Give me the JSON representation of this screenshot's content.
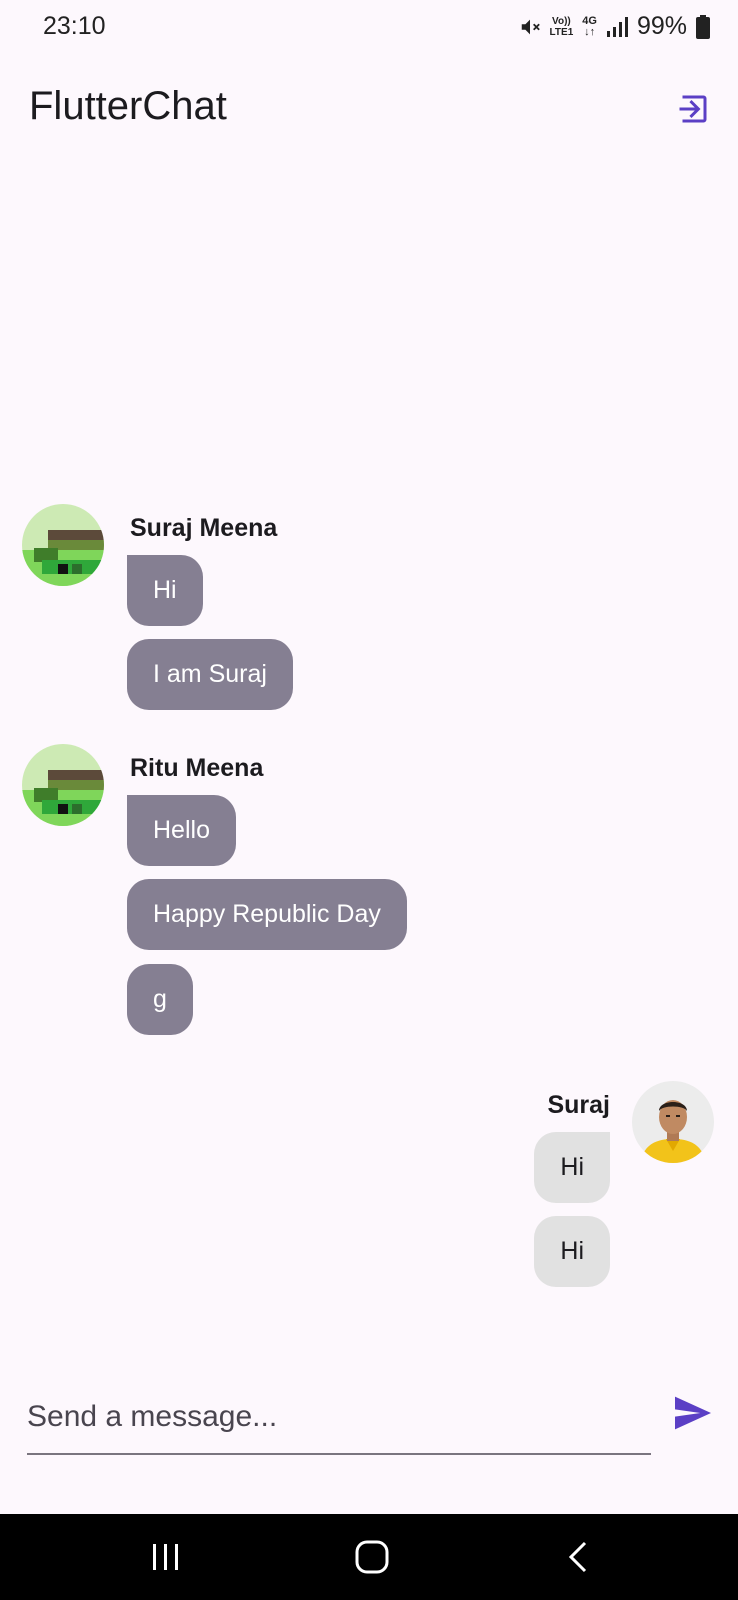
{
  "status_bar": {
    "time": "23:10",
    "volte_top": "Vo))",
    "volte_bottom": "LTE1",
    "network": "4G",
    "battery": "99%"
  },
  "app_bar": {
    "title": "FlutterChat",
    "logout_icon": "logout-icon"
  },
  "colors": {
    "accent": "#5b3fc5",
    "other_bubble": "#857f92",
    "my_bubble": "#e1e1e1",
    "background": "#fdf8fd"
  },
  "messages": [
    {
      "sender": "Suraj Meena",
      "side": "left",
      "bubbles": [
        "Hi",
        "I am Suraj"
      ]
    },
    {
      "sender": "Ritu Meena",
      "side": "left",
      "bubbles": [
        "Hello",
        "Happy Republic Day",
        "g"
      ]
    },
    {
      "sender": "Suraj",
      "side": "right",
      "bubbles": [
        "Hi",
        "Hi"
      ]
    }
  ],
  "composer": {
    "placeholder": "Send a message...",
    "send_icon": "send-icon"
  },
  "nav_bar": {
    "items": [
      "recent-apps-icon",
      "home-icon",
      "back-icon"
    ]
  }
}
